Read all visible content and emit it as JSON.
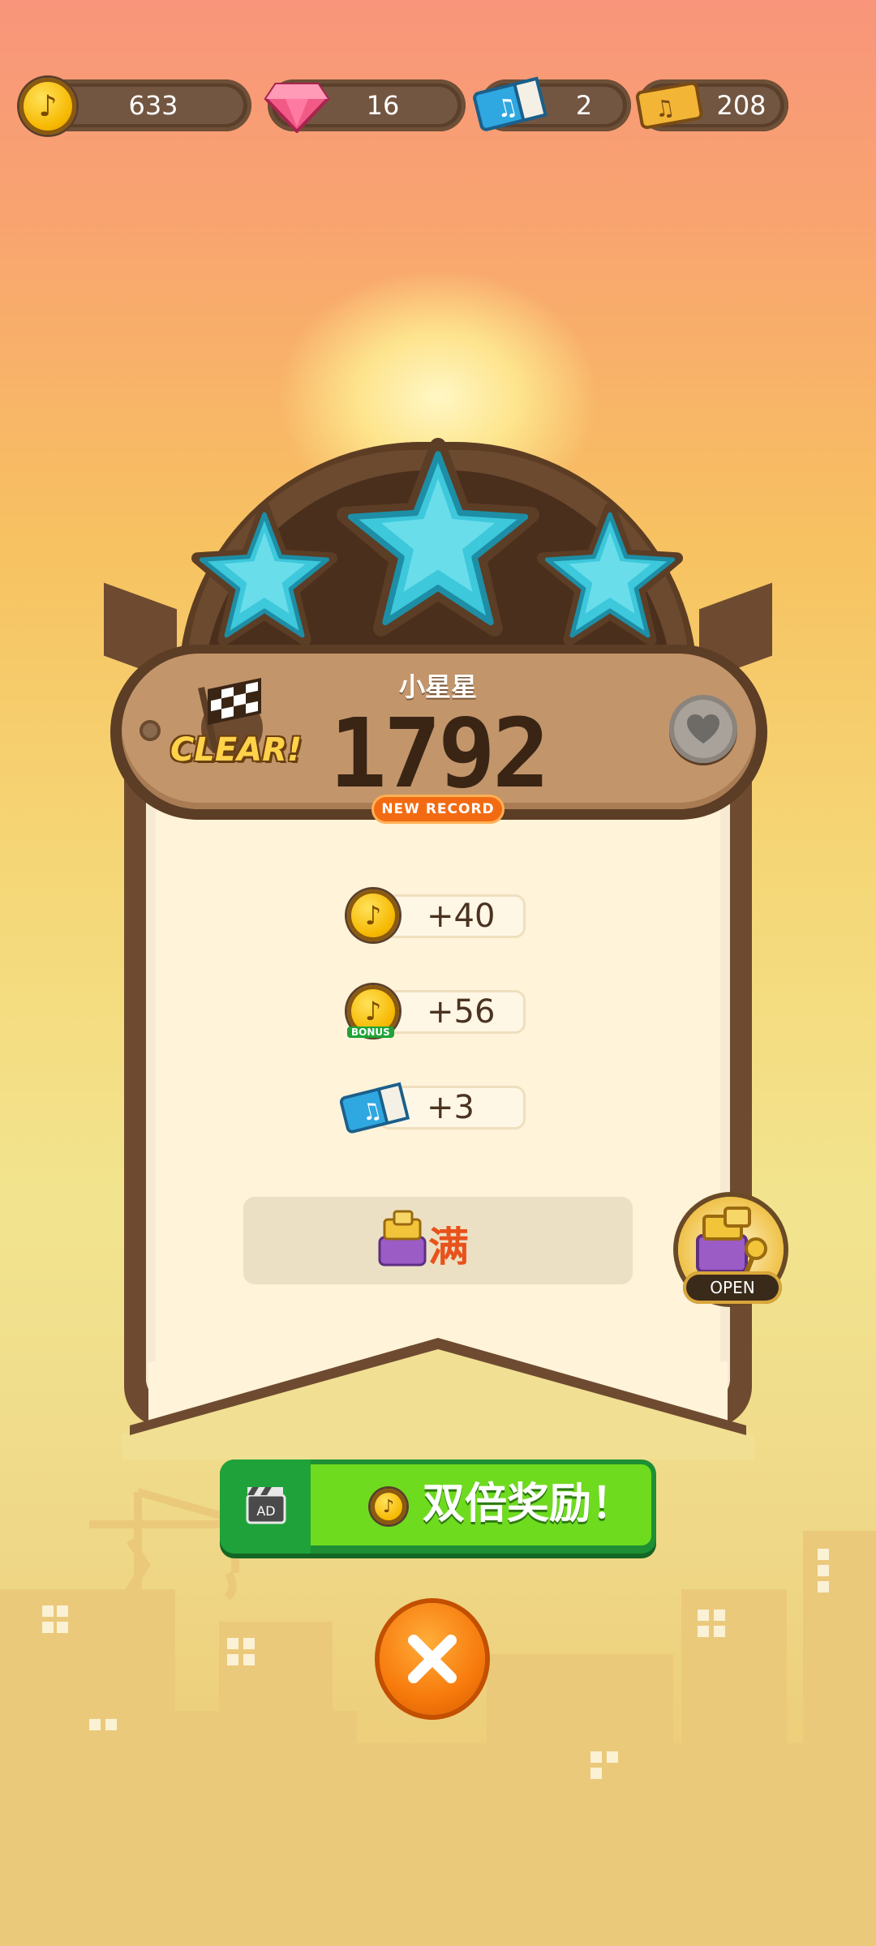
{
  "currency": {
    "coins": "633",
    "gems": "16",
    "tickets": "2",
    "golden_tickets": "208"
  },
  "result": {
    "title": "小星星",
    "score": "1792",
    "clear_label": "CLEAR!",
    "new_record_label": "NEW RECORD",
    "stars_earned": 3
  },
  "rewards": [
    {
      "icon": "coin-icon",
      "value": "+40"
    },
    {
      "icon": "coin-icon",
      "value": "+56",
      "tag": "BONUS"
    },
    {
      "icon": "ticket-icon",
      "value": "+3"
    }
  ],
  "box": {
    "status_label": "满"
  },
  "open_button": {
    "label": "OPEN"
  },
  "ad_button": {
    "ad_tag": "AD",
    "label": "双倍奖励！"
  },
  "colors": {
    "star": "#3dc8dc",
    "wood": "#6e4b30",
    "ad_green": "#6fdb1f",
    "close_orange": "#f77a0c"
  }
}
